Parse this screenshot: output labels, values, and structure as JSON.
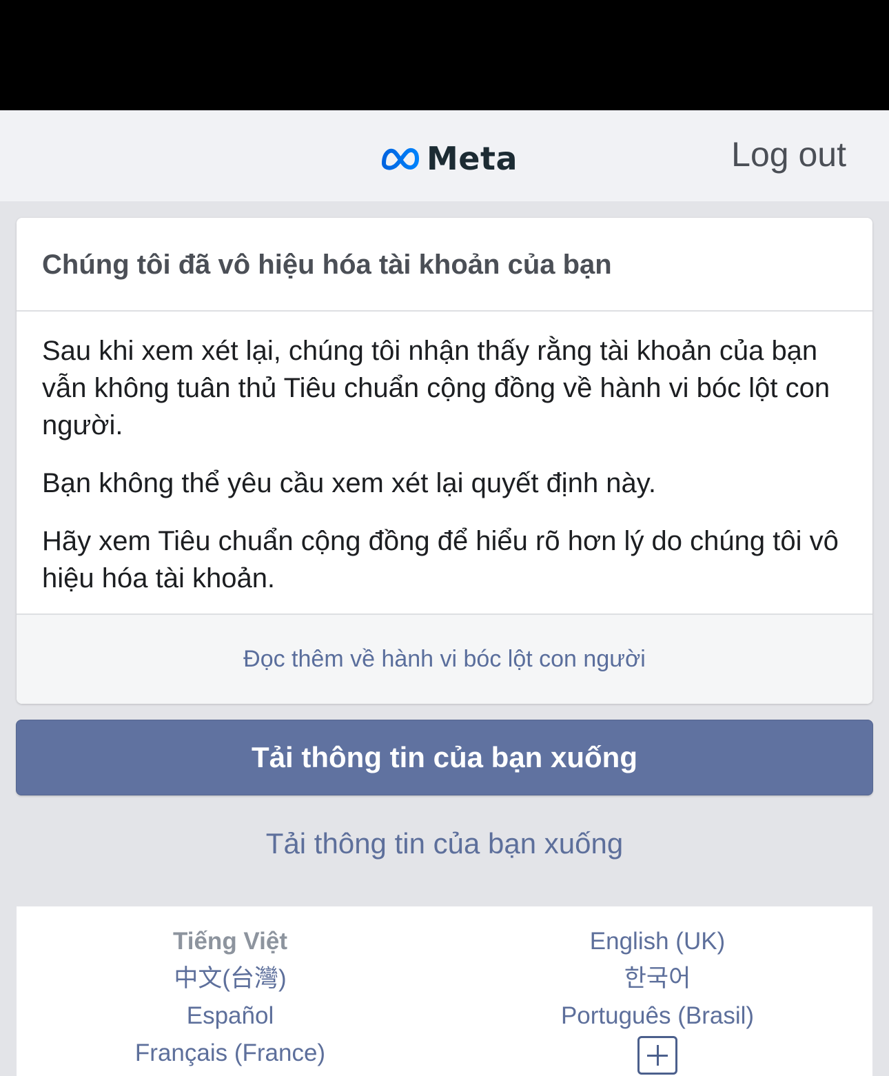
{
  "header": {
    "brand": "Meta",
    "logout_label": "Log out"
  },
  "card": {
    "title": "Chúng tôi đã vô hiệu hóa tài khoản của bạn",
    "paragraphs": [
      "Sau khi xem xét lại, chúng tôi nhận thấy rằng tài khoản của bạn vẫn không tuân thủ Tiêu chuẩn cộng đồng về hành vi bóc lột con người.",
      "Bạn không thể yêu cầu xem xét lại quyết định này.",
      "Hãy xem Tiêu chuẩn cộng đồng để hiểu rõ hơn lý do chúng tôi vô hiệu hóa tài khoản."
    ],
    "footer_link": "Đọc thêm về hành vi bóc lột con người"
  },
  "actions": {
    "primary_label": "Tải thông tin của bạn xuống",
    "secondary_label": "Tải thông tin của bạn xuống"
  },
  "languages": {
    "left": [
      "Tiếng Việt",
      "中文(台灣)",
      "Español",
      "Français (France)"
    ],
    "right": [
      "English (UK)",
      "한국어",
      "Português (Brasil)"
    ],
    "more_icon": "plus-icon"
  },
  "colors": {
    "primary_button": "#6072a0",
    "link": "#5d6f9b",
    "meta_blue": "#0668e1"
  }
}
